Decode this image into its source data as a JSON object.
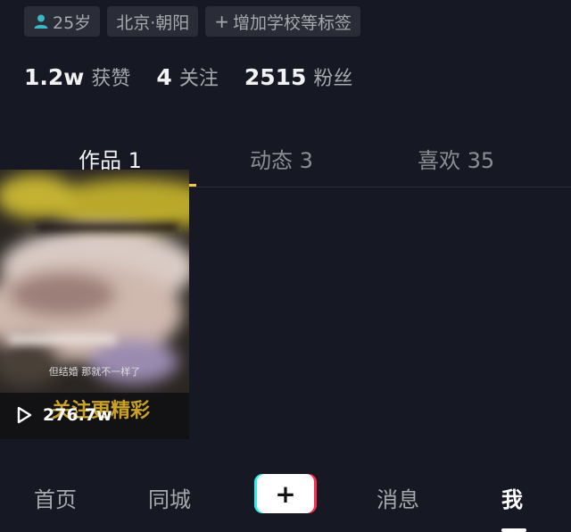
{
  "profile": {
    "tags": [
      {
        "icon": "person-icon",
        "label": "25岁"
      },
      {
        "icon": "",
        "label": "北京·朝阳"
      },
      {
        "icon": "plus-icon",
        "label": "增加学校等标签"
      }
    ],
    "stats": [
      {
        "value": "1.2w",
        "label": "获赞"
      },
      {
        "value": "4",
        "label": "关注"
      },
      {
        "value": "2515",
        "label": "粉丝"
      }
    ]
  },
  "tabs": [
    {
      "label": "作品 1",
      "active": true
    },
    {
      "label": "动态 3",
      "active": false
    },
    {
      "label": "喜欢 35",
      "active": false
    }
  ],
  "video": {
    "subtitle": "但结婚 那就不一样了",
    "caption": "关注更精彩",
    "views": "276.7w",
    "play_icon": "play-icon"
  },
  "bottom_nav": {
    "items": [
      {
        "label": "首页",
        "active": false
      },
      {
        "label": "同城",
        "active": false
      },
      {
        "label": "消息",
        "active": false
      },
      {
        "label": "我",
        "active": true
      }
    ],
    "create_label": "+"
  },
  "colors": {
    "background": "#161823",
    "accent_underline": "#f2c94c",
    "brand_cyan": "#25f4ee",
    "brand_red": "#fe2c55"
  }
}
